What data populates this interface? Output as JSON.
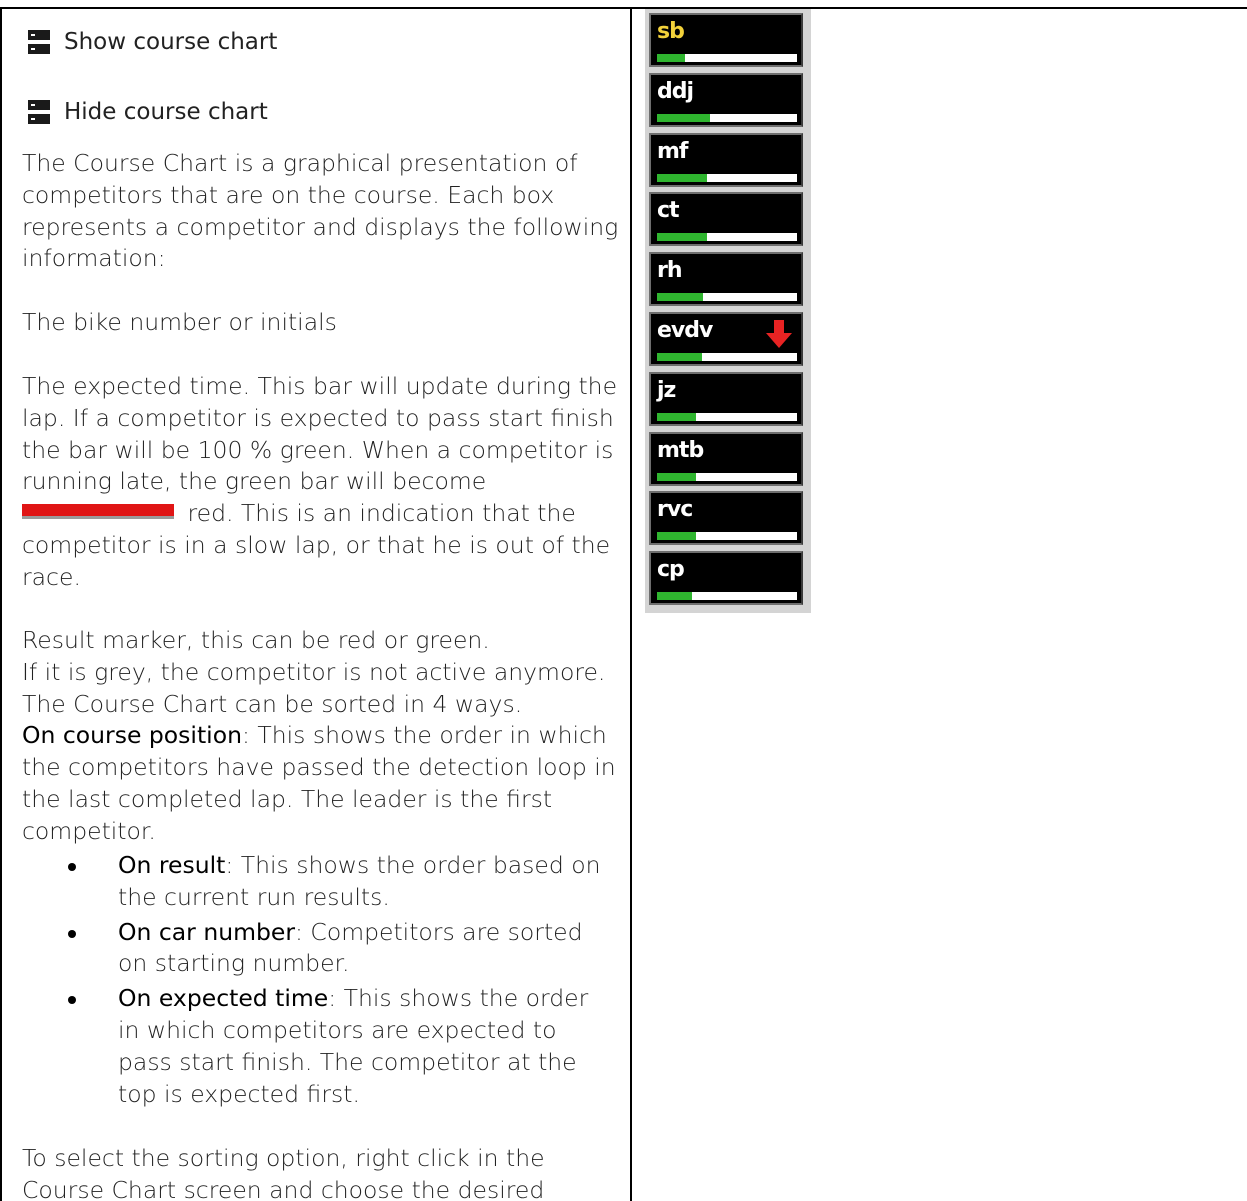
{
  "menu": {
    "show_label": "Show course chart",
    "hide_label": "Hide course chart"
  },
  "intro": {
    "text": "The Course Chart is a graphical presentation of competitors that are on the course. Each box represents a competitor and displays the following information:"
  },
  "bike_number_text": "The bike number or initials",
  "expected_time": {
    "before_swatch": "The expected time. This bar will update during the lap. If a competitor is expected to pass start finish the bar will be 100 % green. When a competitor is running late, the green bar will become",
    "after_swatch": " red. This is an indication that the competitor is in a slow lap, or that he is out of the race."
  },
  "result_marker": {
    "line1": "Result marker, this can be red or green.",
    "line2": "If it is grey, the competitor is not active anymore.",
    "line3": "The Course Chart can be sorted in 4 ways."
  },
  "sort_options": {
    "on_course": {
      "title": "On course position",
      "text": ": This shows the order in which the competitors have passed the detection loop in the last completed lap. The leader is the first competitor."
    },
    "bullets": [
      {
        "title": "On result",
        "text": ": This shows the order based on the current run results."
      },
      {
        "title": "On car number",
        "text": ": Competitors are sorted on starting number."
      },
      {
        "title": "On expected time",
        "text": ": This shows the order in which competitors are expected to pass start finish. The competitor at the top is expected first."
      }
    ]
  },
  "select_text": "To select the sorting option, right click in the Course Chart screen and choose the desired option.",
  "course_chart": {
    "colors": {
      "bar_green": "#2fb52f",
      "bar_empty": "#ffffff",
      "box_bg": "#000000",
      "highlight_text": "#f2d13a",
      "marker_red": "#e82323"
    },
    "competitors": [
      {
        "label": "sb",
        "progress": 0.2,
        "highlight": true,
        "marker": ""
      },
      {
        "label": "ddj",
        "progress": 0.38,
        "highlight": false,
        "marker": ""
      },
      {
        "label": "mf",
        "progress": 0.36,
        "highlight": false,
        "marker": ""
      },
      {
        "label": "ct",
        "progress": 0.36,
        "highlight": false,
        "marker": ""
      },
      {
        "label": "rh",
        "progress": 0.33,
        "highlight": false,
        "marker": ""
      },
      {
        "label": "evdv",
        "progress": 0.32,
        "highlight": false,
        "marker": "red-down-arrow-icon"
      },
      {
        "label": "jz",
        "progress": 0.28,
        "highlight": false,
        "marker": ""
      },
      {
        "label": "mtb",
        "progress": 0.28,
        "highlight": false,
        "marker": ""
      },
      {
        "label": "rvc",
        "progress": 0.28,
        "highlight": false,
        "marker": ""
      },
      {
        "label": "cp",
        "progress": 0.25,
        "highlight": false,
        "marker": ""
      }
    ]
  }
}
